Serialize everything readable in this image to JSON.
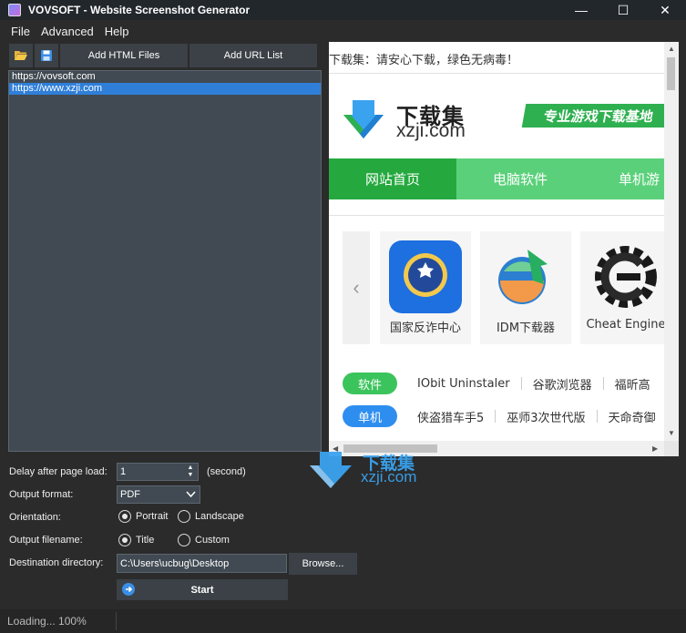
{
  "window": {
    "title": "VOVSOFT - Website Screenshot Generator",
    "minimize_glyph": "—",
    "maximize_glyph": "☐",
    "close_glyph": "✕"
  },
  "menu": [
    "File",
    "Advanced",
    "Help"
  ],
  "toolbar": {
    "open_icon": "folder-open-icon",
    "save_icon": "save-icon",
    "add_html_label": "Add HTML Files",
    "add_url_label": "Add URL List"
  },
  "url_list": {
    "items": [
      "https://vovsoft.com",
      "https://www.xzji.com"
    ],
    "selected_index": 1
  },
  "preview": {
    "notice": "下载集：请安心下载，绿色无病毒！",
    "logo_cn": "下载集",
    "logo_en": "xzji.com",
    "slogan": "专业游戏下载基地",
    "nav": [
      "网站首页",
      "电脑软件",
      "单机游"
    ],
    "carousel_arrow": "‹",
    "apps": [
      {
        "name": "国家反诈中心",
        "icon": "anti-fraud-app-icon"
      },
      {
        "name": "IDM下载器",
        "icon": "idm-globe-icon"
      },
      {
        "name": "Cheat Engine",
        "icon": "cheat-engine-icon"
      }
    ],
    "categories": [
      {
        "pill": "软件",
        "color": "#3cc45c",
        "links": [
          "IObit Uninstaler",
          "谷歌浏览器",
          "福昕高"
        ]
      },
      {
        "pill": "单机",
        "color": "#2e8ef0",
        "links": [
          "侠盗猎车手5",
          "巫师3次世代版",
          "天命奇御"
        ]
      }
    ],
    "scroll_up": "▲",
    "scroll_down": "▼",
    "scroll_left": "◀",
    "scroll_right": "▶"
  },
  "form": {
    "delay_label": "Delay after page load:",
    "delay_value": "1",
    "delay_unit": "(second)",
    "spin_up": "▲",
    "spin_down": "▼",
    "format_label": "Output format:",
    "format_value": "PDF",
    "orientation_label": "Orientation:",
    "portrait_label": "Portrait",
    "landscape_label": "Landscape",
    "orientation_selected": "Portrait",
    "filename_label": "Output filename:",
    "title_label": "Title",
    "custom_label": "Custom",
    "filename_selected": "Title",
    "dest_label": "Destination directory:",
    "dest_value": "C:\\Users\\ucbug\\Desktop",
    "browse_label": "Browse...",
    "start_label": "Start"
  },
  "status": {
    "text": "Loading... 100%"
  },
  "watermark": {
    "cn": "下载集",
    "en": "xzji.com"
  },
  "colors": {
    "accent": "#2f7fd9",
    "nav_green": "#5bd07a",
    "nav_active": "#25a93f",
    "slogan_green": "#2fb050"
  }
}
